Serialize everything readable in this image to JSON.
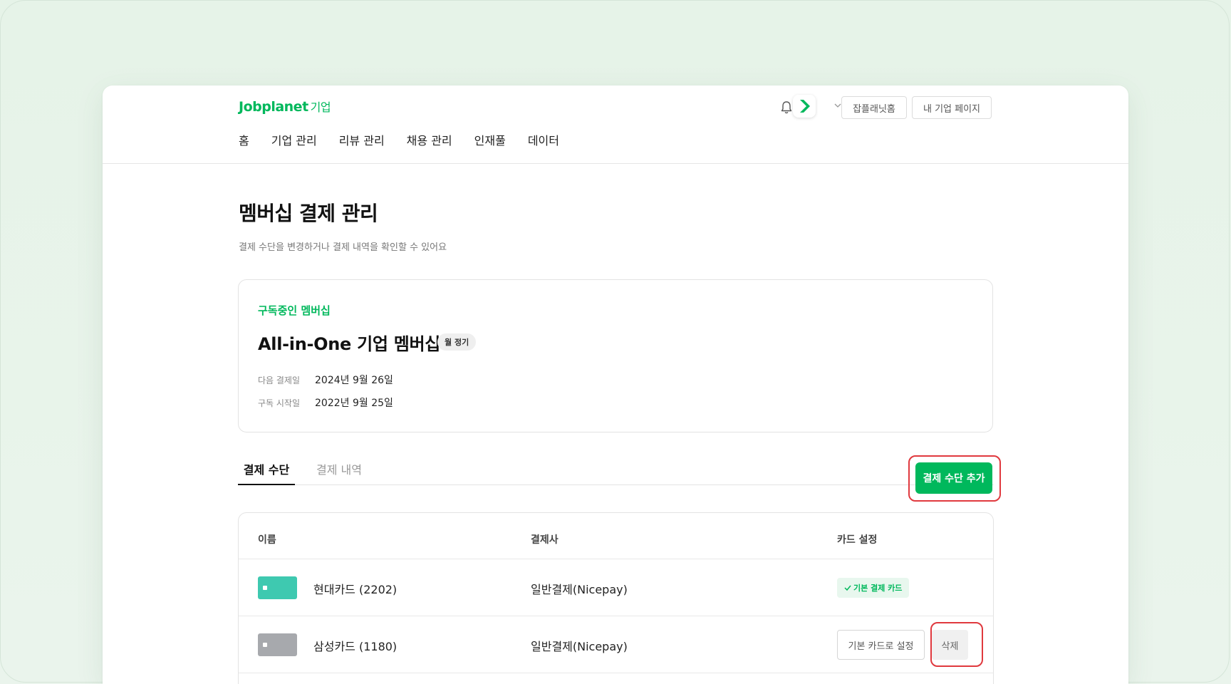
{
  "header": {
    "logo_text": "Jobplanet",
    "logo_sub": "기업",
    "nav": [
      "홈",
      "기업 관리",
      "리뷰 관리",
      "채용 관리",
      "인재풀",
      "데이터"
    ],
    "home_btn": "잡플래닛홈",
    "mypage_btn": "내 기업 페이지"
  },
  "page": {
    "title": "멤버십 결제 관리",
    "subtitle": "결제 수단을 변경하거나 결제 내역을 확인할 수 있어요"
  },
  "subscription": {
    "label": "구독중인 멤버십",
    "name": "All-in-One 기업 멤버십",
    "badge": "월 정기",
    "next_payment_label": "다음 결제일",
    "next_payment_value": "2024년 9월 26일",
    "start_label": "구독 시작일",
    "start_value": "2022년 9월 25일"
  },
  "tabs": {
    "payment_method": "결제 수단",
    "payment_history": "결제 내역"
  },
  "add_button": "결제 수단 추가",
  "table": {
    "headers": {
      "name": "이름",
      "processor": "결제사",
      "card_settings": "카드 설정"
    },
    "rows": [
      {
        "name": "현대카드 (2202)",
        "processor": "일반결제(Nicepay)",
        "chip_color": "#3ec9b0",
        "default_label": "기본 결제 카드"
      },
      {
        "name": "삼성카드 (1180)",
        "processor": "일반결제(Nicepay)",
        "chip_color": "#a7a9ad",
        "set_default_label": "기본 카드로 설정",
        "delete_label": "삭제"
      }
    ]
  },
  "colors": {
    "brand": "#00b85c",
    "highlight": "#e0393e"
  }
}
